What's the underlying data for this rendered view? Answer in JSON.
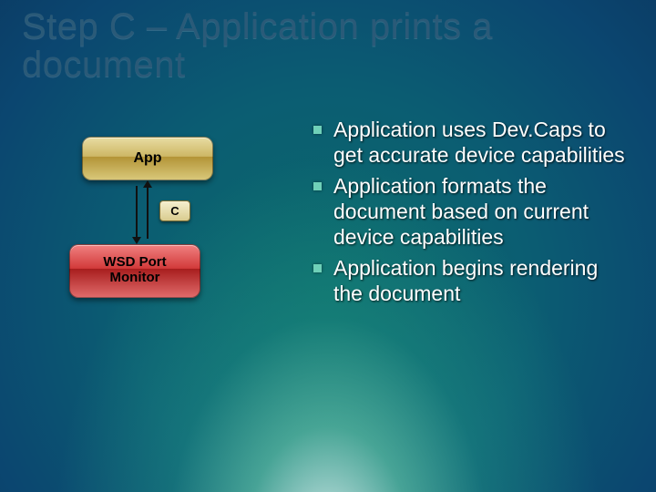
{
  "title": "Step C – Application prints a document",
  "diagram": {
    "app_label": "App",
    "connector_label": "C",
    "wsd_label": "WSD Port\nMonitor"
  },
  "bullets": [
    "Application uses Dev.Caps to get accurate device capabilities",
    "Application formats the document based on current device capabilities",
    "Application begins rendering the document"
  ]
}
